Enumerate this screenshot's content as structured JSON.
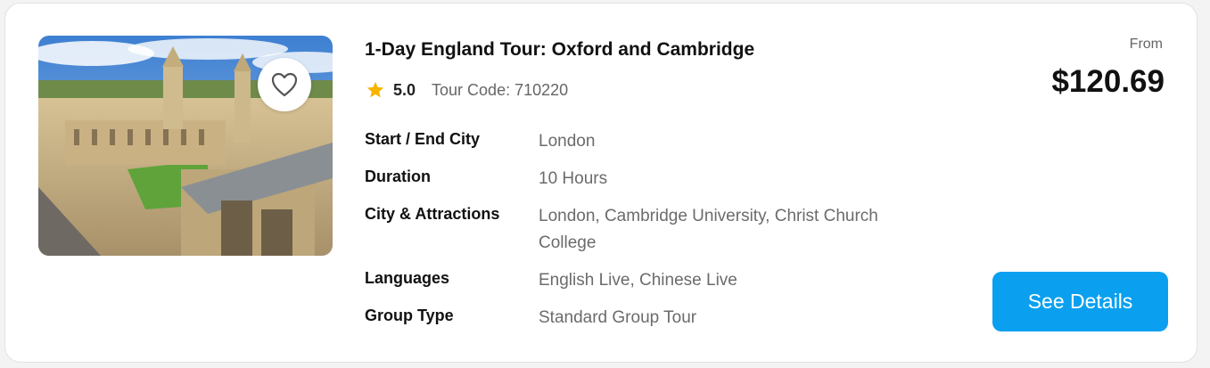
{
  "tour": {
    "title": "1-Day England Tour: Oxford and Cambridge",
    "rating": "5.0",
    "tour_code_label": "Tour Code:",
    "tour_code": "710220"
  },
  "details": [
    {
      "label": "Start / End City",
      "value": "London"
    },
    {
      "label": "Duration",
      "value": "10 Hours"
    },
    {
      "label": "City & Attractions",
      "value": "London, Cambridge University, Christ Church College"
    },
    {
      "label": "Languages",
      "value": "English Live, Chinese Live"
    },
    {
      "label": "Group Type",
      "value": "Standard Group Tour"
    }
  ],
  "pricing": {
    "from_label": "From",
    "price": "$120.69"
  },
  "actions": {
    "see_details_label": "See Details"
  },
  "icons": {
    "favorite": "heart-outline-icon",
    "rating": "star-icon"
  },
  "colors": {
    "accent": "#0aa0ef",
    "star": "#f7b500"
  }
}
